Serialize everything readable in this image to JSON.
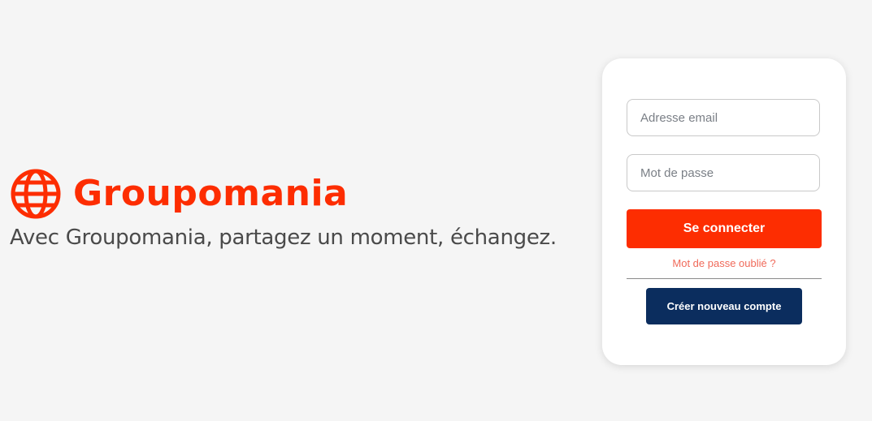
{
  "brand": {
    "name": "Groupomania",
    "tagline": "Avec Groupomania, partagez un moment, échangez.",
    "accent_color": "#fd2d01",
    "logo_icon": "globe-icon"
  },
  "login_form": {
    "email_placeholder": "Adresse email",
    "email_value": "",
    "password_placeholder": "Mot de passe",
    "password_value": "",
    "submit_label": "Se connecter",
    "forgot_password_label": "Mot de passe oublié ?",
    "create_account_label": "Créer nouveau compte",
    "primary_color": "#fd2d01",
    "secondary_color": "#0b2d5e"
  }
}
